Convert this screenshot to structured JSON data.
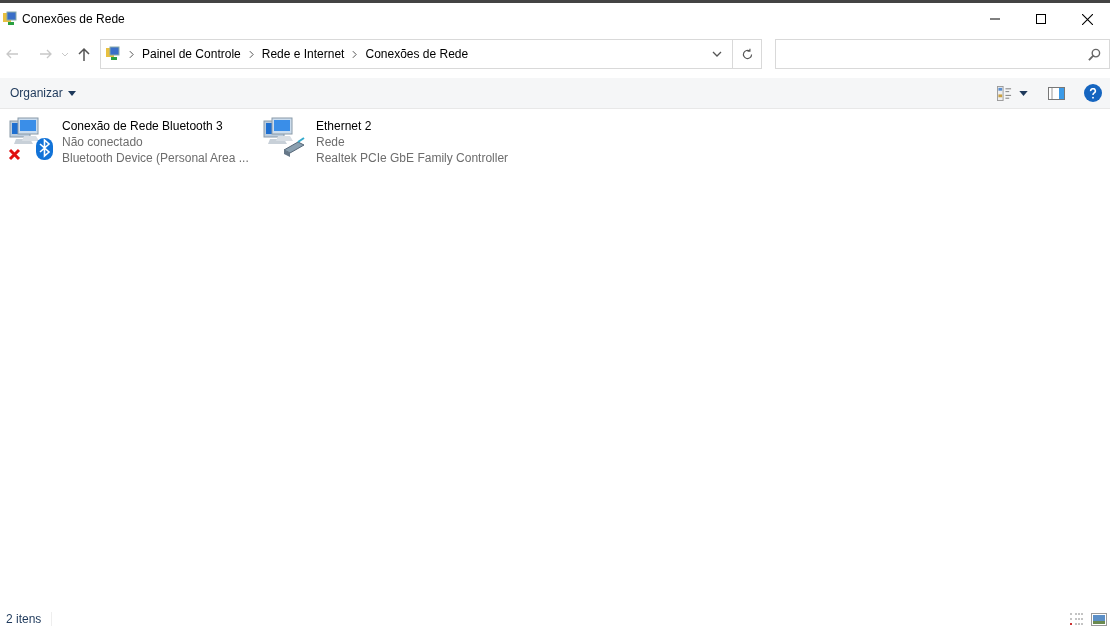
{
  "window": {
    "title": "Conexões de Rede"
  },
  "breadcrumb": [
    "Painel de Controle",
    "Rede e Internet",
    "Conexões de Rede"
  ],
  "toolbar": {
    "organize": "Organizar"
  },
  "items": [
    {
      "kind": "bluetooth",
      "name": "Conexão de Rede Bluetooth 3",
      "status": "Não conectado",
      "device": "Bluetooth Device (Personal Area ...",
      "disconnected": true
    },
    {
      "kind": "ethernet",
      "name": "Ethernet 2",
      "status": "Rede",
      "device": "Realtek PCIe GbE Family Controller",
      "disconnected": false
    }
  ],
  "status_bar": {
    "count": "2 itens"
  }
}
